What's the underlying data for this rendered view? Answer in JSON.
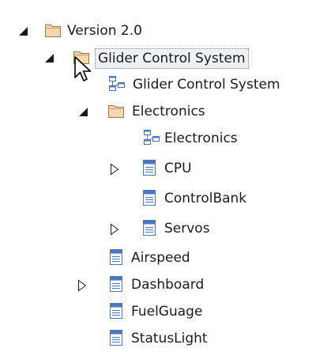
{
  "tree": {
    "root": {
      "label": "Version 2.0",
      "icon": "folder-icon",
      "expanded": true
    },
    "glider_package": {
      "label": "Glider Control System",
      "icon": "folder-icon",
      "expanded": true,
      "selected": true
    },
    "glider_diagram": {
      "label": "Glider Control System",
      "icon": "diagram-icon"
    },
    "electronics_package": {
      "label": "Electronics",
      "icon": "folder-icon",
      "expanded": true
    },
    "electronics_diagram": {
      "label": "Electronics",
      "icon": "diagram-icon"
    },
    "cpu": {
      "label": "CPU",
      "icon": "class-icon",
      "expanded": false
    },
    "controlbank": {
      "label": "ControlBank",
      "icon": "class-icon"
    },
    "servos": {
      "label": "Servos",
      "icon": "class-icon",
      "expanded": false
    },
    "airspeed": {
      "label": "Airspeed",
      "icon": "class-icon"
    },
    "dashboard": {
      "label": "Dashboard",
      "icon": "class-icon",
      "expanded": false
    },
    "fuelguage": {
      "label": "FuelGuage",
      "icon": "class-icon"
    },
    "statuslight": {
      "label": "StatusLight",
      "icon": "class-icon"
    }
  },
  "colors": {
    "folder_fill": "#f7d7b0",
    "folder_stroke": "#a6743d",
    "class_blue": "#4a78c0",
    "selection_bg": "#eef2f7"
  }
}
